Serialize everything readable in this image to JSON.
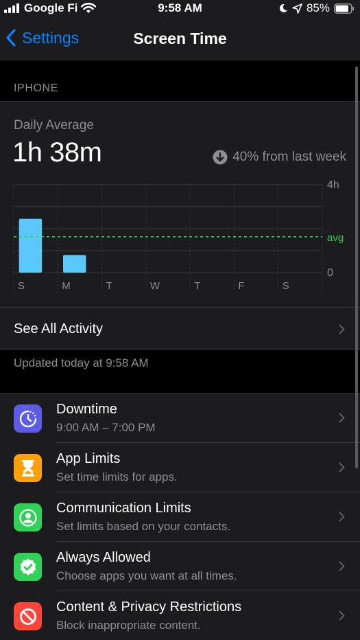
{
  "status_bar": {
    "carrier": "Google Fi",
    "time": "9:58 AM",
    "battery": "85%",
    "battery_level": 0.85
  },
  "nav": {
    "back_label": "Settings",
    "title": "Screen Time"
  },
  "section_header": "IPHONE",
  "summary": {
    "daily_label": "Daily Average",
    "daily_value": "1h 38m",
    "change_text": "40% from last week",
    "see_all_label": "See All Activity"
  },
  "chart_data": {
    "type": "bar",
    "categories": [
      "S",
      "M",
      "T",
      "W",
      "T",
      "F",
      "S"
    ],
    "values": [
      2.45,
      0.8,
      0,
      0,
      0,
      0,
      0
    ],
    "ylim": [
      0,
      4
    ],
    "y_tick_labels": [
      "4h",
      "0"
    ],
    "avg_label": "avg",
    "avg_value": 1.63,
    "grid": true,
    "bar_color": "#5ac8fa",
    "avg_color": "#30d158"
  },
  "updated_text": "Updated today at 9:58 AM",
  "list": {
    "items": [
      {
        "title": "Downtime",
        "subtitle": "9:00 AM – 7:00 PM",
        "icon": "downtime-icon",
        "color": "#5e5ce6"
      },
      {
        "title": "App Limits",
        "subtitle": "Set time limits for apps.",
        "icon": "hourglass-icon",
        "color": "#ff9f0a"
      },
      {
        "title": "Communication Limits",
        "subtitle": "Set limits based on your contacts.",
        "icon": "contact-icon",
        "color": "#30d158"
      },
      {
        "title": "Always Allowed",
        "subtitle": "Choose apps you want at all times.",
        "icon": "checkmark-seal-icon",
        "color": "#30d158"
      },
      {
        "title": "Content & Privacy Restrictions",
        "subtitle": "Block inappropriate content.",
        "icon": "no-entry-icon",
        "color": "#ff453a"
      }
    ]
  }
}
